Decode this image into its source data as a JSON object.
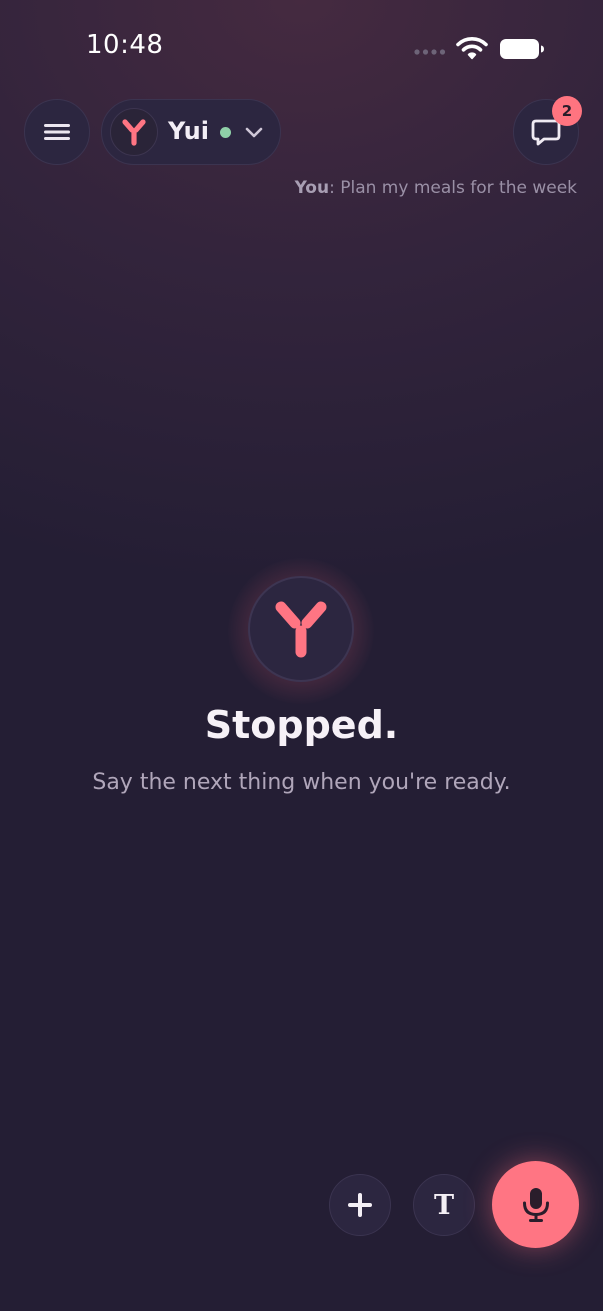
{
  "status_bar": {
    "time": "10:48"
  },
  "header": {
    "agent_name": "Yui",
    "agent_status": "online",
    "unread_count": "2",
    "last_message_sender": "You",
    "last_message_text": "Plan my meals for the week"
  },
  "main": {
    "headline": "Stopped.",
    "subtitle": "Say the next thing when you're ready."
  },
  "controls": {
    "text_glyph": "T"
  },
  "icons": {
    "menu": "hamburger-icon",
    "chat": "chat-bubble-icon",
    "logo": "y-logo-icon",
    "plus": "plus-icon",
    "mic": "microphone-icon",
    "chevron": "chevron-down-icon"
  },
  "colors": {
    "accent": "#ff7583",
    "online": "#8fd0a8",
    "background": "#231e33"
  }
}
